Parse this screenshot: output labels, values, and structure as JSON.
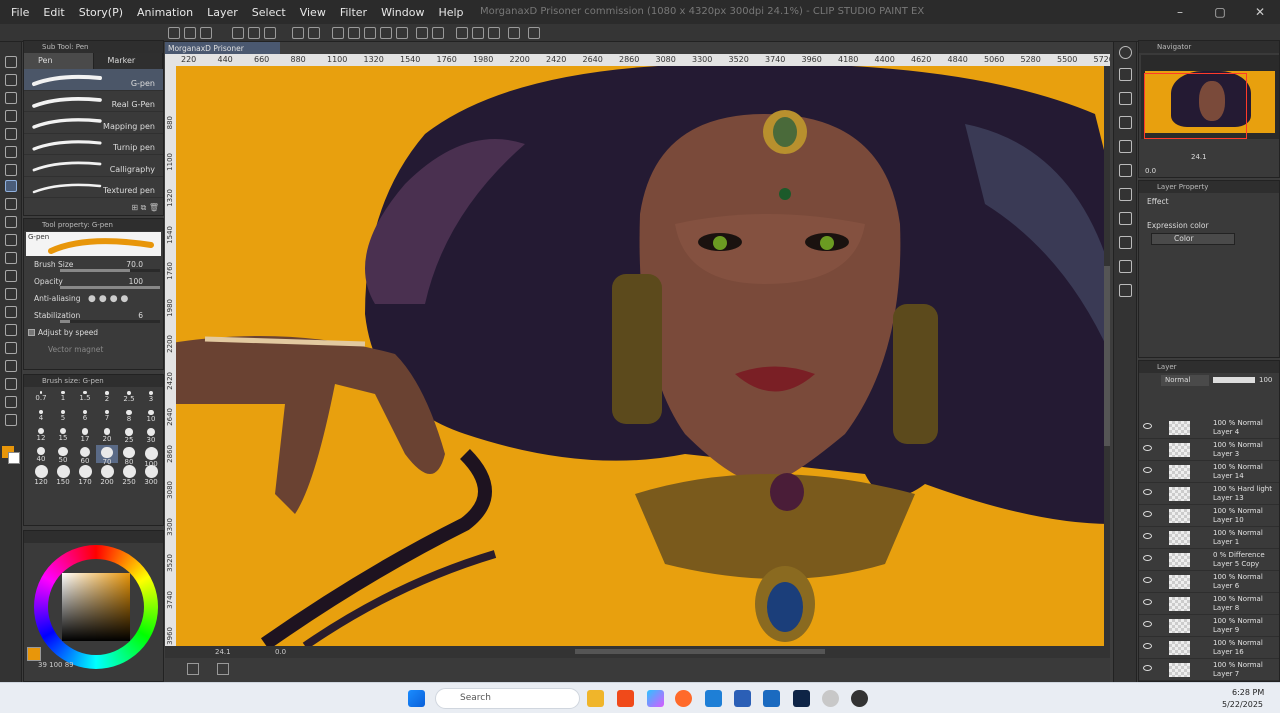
{
  "app": {
    "title": "MorganaxD Prisoner commission (1080 x 4320px 300dpi 24.1%) - CLIP STUDIO PAINT EX",
    "menu": [
      "File",
      "Edit",
      "Story(P)",
      "Animation",
      "Layer",
      "Select",
      "View",
      "Filter",
      "Window",
      "Help"
    ]
  },
  "document_tab": "MorganaxD Prisoner commission",
  "subtool": {
    "header": "Sub Tool: Pen",
    "tabs": [
      "Pen",
      "Marker"
    ],
    "brushes": [
      "G-pen",
      "Real G-Pen",
      "Mapping pen",
      "Turnip pen",
      "Calligraphy",
      "Textured pen"
    ]
  },
  "tool_property": {
    "header": "Tool property: G-pen",
    "preview_label": "G-pen",
    "brush_size_label": "Brush Size",
    "brush_size_value": "70.0",
    "opacity_label": "Opacity",
    "opacity_value": "100",
    "antialiasing_label": "Anti-aliasing",
    "stabilization_label": "Stabilization",
    "stabilization_value": "6",
    "adjust_label": "Adjust by speed",
    "vector_label": "Vector magnet"
  },
  "brush_size_panel": {
    "header": "Brush size: G-pen",
    "sizes": [
      "0.7",
      "1",
      "1.5",
      "2",
      "2.5",
      "3",
      "4",
      "5",
      "6",
      "7",
      "8",
      "10",
      "12",
      "15",
      "17",
      "20",
      "25",
      "30",
      "40",
      "50",
      "60",
      "70",
      "80",
      "100",
      "120",
      "150",
      "170",
      "200",
      "250",
      "300"
    ]
  },
  "color": {
    "main": "#e8960a",
    "sub": "#ffffff",
    "status": "39  100  89"
  },
  "ruler": {
    "top": [
      "220",
      "440",
      "660",
      "880",
      "1100",
      "1320",
      "1540",
      "1760",
      "1980",
      "2200",
      "2420",
      "2640",
      "2860",
      "3080",
      "3300",
      "3520",
      "3740",
      "3960",
      "4180",
      "4400",
      "4620",
      "4840",
      "5060",
      "5280",
      "5500",
      "5720"
    ],
    "left": [
      "880",
      "1100",
      "1320",
      "1540",
      "1760",
      "1980",
      "2200",
      "2420",
      "2640",
      "2860",
      "3080",
      "3300",
      "3520",
      "3740",
      "3960"
    ]
  },
  "canvas_status": {
    "zoom": "24.1",
    "rotation": "0.0"
  },
  "navigator": {
    "header": "Navigator",
    "zoom": "24.1",
    "rotation": "0.0"
  },
  "layer_property": {
    "header": "Layer Property",
    "effect_label": "Effect",
    "expression_label": "Expression color",
    "expression_value": "Color"
  },
  "layer_panel": {
    "header": "Layer",
    "blend_mode": "Normal",
    "opacity": "100",
    "layers": [
      {
        "blend": "100 % Normal",
        "name": "Layer 4"
      },
      {
        "blend": "100 % Normal",
        "name": "Layer 3"
      },
      {
        "blend": "100 % Normal",
        "name": "Layer 14"
      },
      {
        "blend": "100 % Hard light",
        "name": "Layer 13"
      },
      {
        "blend": "100 % Normal",
        "name": "Layer 10"
      },
      {
        "blend": "100 % Normal",
        "name": "Layer 1"
      },
      {
        "blend": "0 % Difference",
        "name": "Layer 5 Copy"
      },
      {
        "blend": "100 % Normal",
        "name": "Layer 6"
      },
      {
        "blend": "100 % Normal",
        "name": "Layer 8"
      },
      {
        "blend": "100 % Normal",
        "name": "Layer 9"
      },
      {
        "blend": "100 % Normal",
        "name": "Layer 16"
      },
      {
        "blend": "100 % Normal",
        "name": "Layer 7"
      }
    ]
  },
  "taskbar": {
    "search_placeholder": "Search",
    "time": "6:28 PM",
    "date": "5/22/2025",
    "apps": [
      "windows-start",
      "search",
      "file-explorer",
      "brave",
      "copilot",
      "firefox",
      "vscode",
      "word",
      "store",
      "photoshop",
      "clip-studio",
      "help"
    ]
  }
}
